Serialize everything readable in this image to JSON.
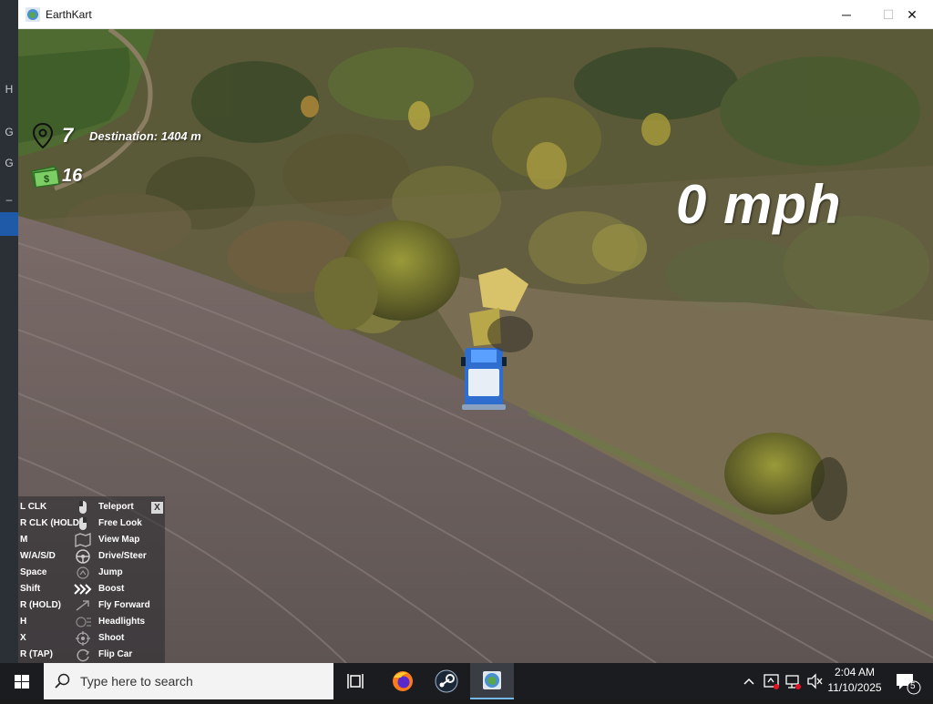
{
  "window": {
    "title": "EarthKart",
    "minimize": "─",
    "maximize": "☐",
    "close": "✕"
  },
  "desktop_left": {
    "marks": [
      "H",
      "G",
      "G",
      "–"
    ]
  },
  "hud": {
    "destination_count": "7",
    "destination_label": "Destination: 1404 m",
    "cash": "16",
    "speed": "0 mph"
  },
  "controls": {
    "close_label": "X",
    "rows": [
      {
        "key": "L CLK",
        "action": "Teleport",
        "icon": "mouse-left-icon"
      },
      {
        "key": "R CLK (HOLD)",
        "action": "Free Look",
        "icon": "mouse-right-icon"
      },
      {
        "key": "M",
        "action": "View Map",
        "icon": "map-icon"
      },
      {
        "key": "W/A/S/D",
        "action": "Drive/Steer",
        "icon": "steering-wheel-icon"
      },
      {
        "key": "Space",
        "action": "Jump",
        "icon": "jump-icon"
      },
      {
        "key": "Shift",
        "action": "Boost",
        "icon": "boost-chevrons-icon"
      },
      {
        "key": "R (HOLD)",
        "action": "Fly Forward",
        "icon": "fly-icon"
      },
      {
        "key": "H",
        "action": "Headlights",
        "icon": "headlights-icon"
      },
      {
        "key": "X",
        "action": "Shoot",
        "icon": "crosshair-icon"
      },
      {
        "key": "R (TAP)",
        "action": "Flip Car",
        "icon": "flip-icon"
      }
    ]
  },
  "taskbar": {
    "search_placeholder": "Type here to search",
    "time": "2:04 AM",
    "date": "11/10/2025",
    "notification_count": "5"
  },
  "colors": {
    "accent": "#76b9ed",
    "taskbar": "#1b1c1f",
    "hud_text": "#ffffff"
  }
}
